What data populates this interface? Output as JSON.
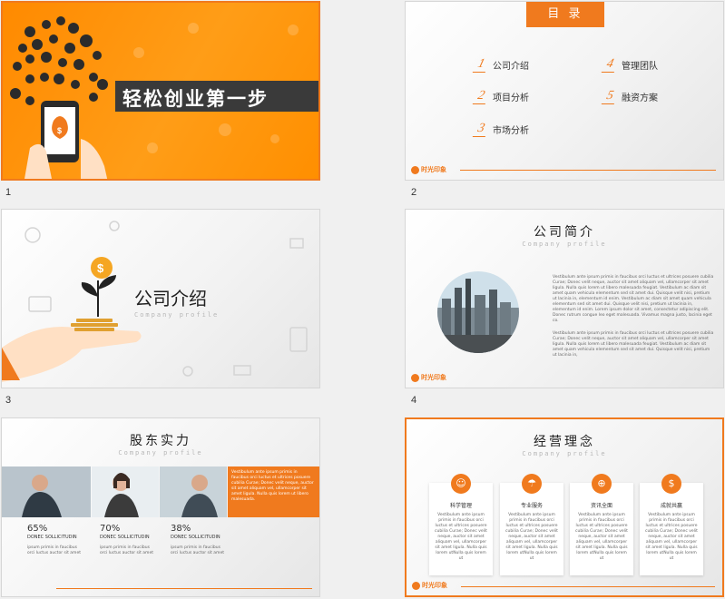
{
  "colors": {
    "accent": "#f07a1e",
    "slide1_bg": "#ff8f00",
    "banner": "#3a3a3a"
  },
  "slide_numbers": [
    "1",
    "2",
    "3",
    "4",
    "5",
    "6"
  ],
  "slide1": {
    "title": "轻松创业第一步"
  },
  "slide2": {
    "header": "目 录",
    "items": [
      {
        "n": "1",
        "label": "公司介绍"
      },
      {
        "n": "2",
        "label": "项目分析"
      },
      {
        "n": "3",
        "label": "市场分析"
      },
      {
        "n": "4",
        "label": "管理团队"
      },
      {
        "n": "5",
        "label": "融资方案"
      }
    ]
  },
  "logo_text": "时光印象",
  "slide3": {
    "title": "公司介绍",
    "subtitle": "Company profile"
  },
  "slide4": {
    "title": "公司简介",
    "subtitle": "Company profile",
    "para1": "Vestibulum ante ipsum primis in faucibus orci luctus et ultrices posuere cubilia Curae; Donec velit neque, auctor sit amet aliquam vel, ullamcorper sit amet ligula. Nulla quis lorem ut libero malesuada feugiat. Vestibulum ac diam sit amet quam vehicula elementum sed sit amet dui. Quisque velit nisi, pretium ut lacinia in, elementum id enim. Vestibulum ac diam sit amet quam vehicula elementum sed sit amet dui. Quisque velit nisi, pretium ut lacinia in, elementum id enim. Lorem ipsum dolor sit amet, consectetur adipiscing elit. Donec rutrum congue leo eget malesuada. Vivamus magna justo, lacinia eget co.",
    "para2": "Vestibulum ante ipsum primis in faucibus orci luctus et ultrices posuere cubilia Curae; Donec velit neque, auctor sit amet aliquam vel, ullamcorper sit amet ligula. Nulla quis lorem ut libero malesuada feugiat. Vestibulum ac diam sit amet quam vehicula elementum sed sit amet dui. Quisque velit nisi, pretium ut lacinia in,"
  },
  "slide5": {
    "title": "股东实力",
    "subtitle": "Company profile",
    "orange_text": "Vestibulum ante ipsum primis in faucibus orci luctus et ultrices posuere cubilia Curae; Donec velit neque, auctor sit amet aliquam vel, ullamcorper sit amet ligula. Nulla quis lorem ut libero malesuada.",
    "stats": [
      {
        "pct": "65%",
        "label": "DONEC SOLLICITUDIN",
        "desc": "ipsum primis in faucibus orci luctus auctor sit amet"
      },
      {
        "pct": "70%",
        "label": "DONEC SOLLICITUDIN",
        "desc": "ipsum primis in faucibus orci luctus auctor sit amet"
      },
      {
        "pct": "38%",
        "label": "DONEC SOLLICITUDIN",
        "desc": "ipsum primis in faucibus orci luctus auctor sit amet"
      }
    ]
  },
  "slide6": {
    "title": "经营理念",
    "subtitle": "Company profile",
    "cards": [
      {
        "icon": "☺",
        "title": "科学管理",
        "body": "Vestibulum ante ipsum primis in faucibus orci luctus et ultrices posuere cubilia Curae; Donec velit neque, auctor sit amet aliquam vel, ullamcorper sit amet ligula. Nulla quis lorem utNulla quis lorem ut"
      },
      {
        "icon": "☂",
        "title": "专业服务",
        "body": "Vestibulum ante ipsum primis in faucibus orci luctus et ultrices posuere cubilia Curae; Donec velit neque, auctor sit amet aliquam vel, ullamcorper sit amet ligula. Nulla quis lorem utNulla quis lorem ut"
      },
      {
        "icon": "⊕",
        "title": "资讯全面",
        "body": "Vestibulum ante ipsum primis in faucibus orci luctus et ultrices posuere cubilia Curae; Donec velit neque, auctor sit amet aliquam vel, ullamcorper sit amet ligula. Nulla quis lorem utNulla quis lorem ut"
      },
      {
        "icon": "$",
        "title": "成就共赢",
        "body": "Vestibulum ante ipsum primis in faucibus orci luctus et ultrices posuere cubilia Curae; Donec velit neque, auctor sit amet aliquam vel, ullamcorper sit amet ligula. Nulla quis lorem utNulla quis lorem ut"
      }
    ]
  }
}
